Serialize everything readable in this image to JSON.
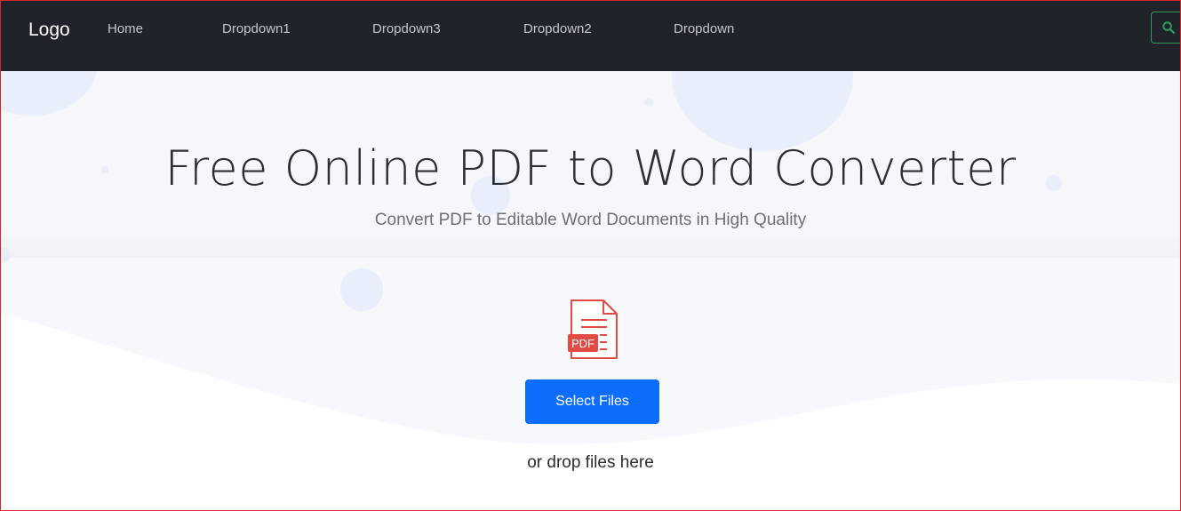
{
  "navbar": {
    "logo": "Logo",
    "links": [
      "Home",
      "Dropdown1",
      "Dropdown3",
      "Dropdown2",
      "Dropdown"
    ],
    "search_icon": "search-icon",
    "search_color": "#2f9e5b"
  },
  "hero": {
    "title": "Free Online PDF to Word Converter",
    "subtitle": "Convert PDF to Editable Word Documents in High Quality"
  },
  "upload": {
    "file_icon": "pdf-file-icon",
    "file_badge": "PDF",
    "select_button": "Select Files",
    "drop_hint": "or drop files here"
  },
  "colors": {
    "nav_bg": "#20242a",
    "primary": "#0d6efd",
    "pdf_red": "#e04c43"
  }
}
